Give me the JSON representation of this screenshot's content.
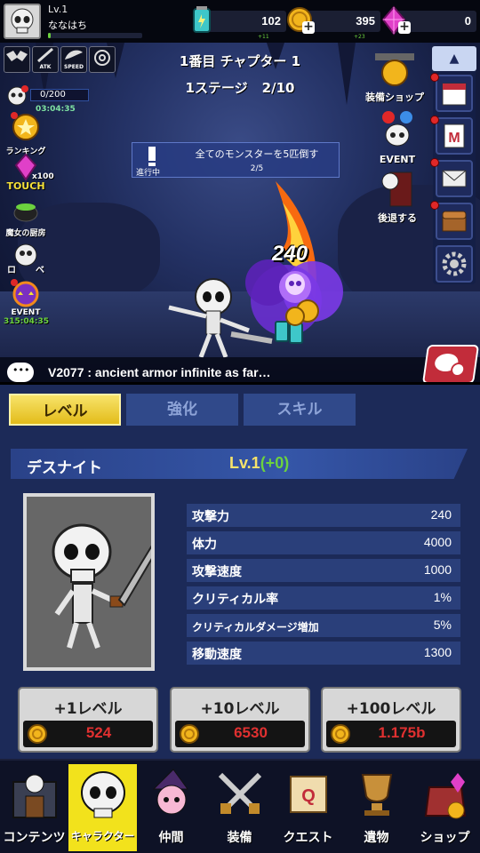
{
  "player": {
    "level": "Lv.1",
    "name": "ななはち",
    "exp_fraction": 0.03
  },
  "currency": [
    {
      "name": "energy",
      "value": "102",
      "sub": "+11"
    },
    {
      "name": "gold",
      "value": "395",
      "sub": "+23"
    },
    {
      "name": "gem",
      "value": "0"
    }
  ],
  "buffs": [
    "",
    "ATK",
    "SPEED",
    ""
  ],
  "gauge": {
    "value": "0/200",
    "timer": "03:04:35"
  },
  "left_icons": {
    "ranking": "ランキング",
    "touch_count": "x100",
    "touch": "TOUCH",
    "witch": "魔女の厨房",
    "roulette": "ロ",
    "roulette_suffix": "ベ",
    "event": "EVENT",
    "event_timer": "315:04:35"
  },
  "stage": {
    "chapter": "1番目 チャプター 1",
    "stage": "1ステージ",
    "progress": "2/10"
  },
  "right_icons": {
    "shop": "装備ショップ",
    "event": "EVENT",
    "retreat": "後退する",
    "mail_badge": "M"
  },
  "quest": {
    "state": "進行中",
    "title": "全てのモンスターを5匹倒す",
    "progress": "2/5"
  },
  "damage": "240",
  "chat": {
    "message": "V2077 : ancient armor infinite as far…"
  },
  "tabs": [
    {
      "label": "レベル",
      "active": true
    },
    {
      "label": "強化",
      "active": false
    },
    {
      "label": "スキル",
      "active": false
    }
  ],
  "character": {
    "name": "デスナイト",
    "level": "Lv.1",
    "bonus": "(+0)"
  },
  "stats": [
    {
      "key": "攻撃力",
      "value": "240"
    },
    {
      "key": "体力",
      "value": "4000"
    },
    {
      "key": "攻撃速度",
      "value": "1000"
    },
    {
      "key": "クリティカル率",
      "value": "1%"
    },
    {
      "key": "クリティカルダメージ増加",
      "value": "5%"
    },
    {
      "key": "移動速度",
      "value": "1300"
    }
  ],
  "upgrades": [
    {
      "label": "+1レベル",
      "cost": "524"
    },
    {
      "label": "+10レベル",
      "cost": "6530"
    },
    {
      "label": "+100レベル",
      "cost": "1.175b"
    }
  ],
  "nav": [
    {
      "label": "コンテンツ",
      "icon": "gate-icon",
      "active": false
    },
    {
      "label": "キャラクター",
      "icon": "skull-icon",
      "active": true
    },
    {
      "label": "仲間",
      "icon": "witch-icon",
      "active": false
    },
    {
      "label": "装備",
      "icon": "swords-icon",
      "active": false
    },
    {
      "label": "クエスト",
      "icon": "scroll-icon",
      "active": false
    },
    {
      "label": "遺物",
      "icon": "trophy-icon",
      "active": false
    },
    {
      "label": "ショップ",
      "icon": "bag-icon",
      "active": false
    }
  ],
  "colors": {
    "accent_gold": "#f7e36a",
    "panel_bg": "#1c2a58",
    "cost_red": "#e03030",
    "bonus_green": "#6cd23e"
  }
}
